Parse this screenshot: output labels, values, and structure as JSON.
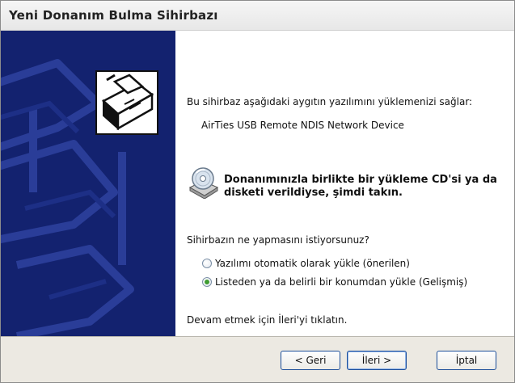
{
  "window": {
    "title": "Yeni Donanım Bulma Sihirbazı"
  },
  "content": {
    "intro": "Bu sihirbaz aşağıdaki aygıtın yazılımını yüklemenizi sağlar:",
    "device_name": "AirTies USB Remote NDIS Network Device",
    "cd_prompt_line1": "Donanımınızla birlikte bir yükleme CD'si ya da",
    "cd_prompt_line2": "disketi verildiyse, şimdi takın.",
    "question": "Sihirbazın ne yapmasını istiyorsunuz?",
    "options": [
      {
        "label": "Yazılımı otomatik olarak yükle (önerilen)",
        "selected": false
      },
      {
        "label": "Listeden ya da belirli bir konumdan yükle (Gelişmiş)",
        "selected": true
      }
    ],
    "continue_hint": "Devam etmek için İleri'yi tıklatın."
  },
  "buttons": {
    "back": "< Geri",
    "next": "İleri >",
    "cancel": "İptal"
  },
  "colors": {
    "banner": "#13226f",
    "radio_selected": "#3f9c31",
    "footer": "#ece9e2"
  },
  "icons": {
    "wizard": "hardware-install-icon",
    "cd": "cd-disk-icon"
  }
}
